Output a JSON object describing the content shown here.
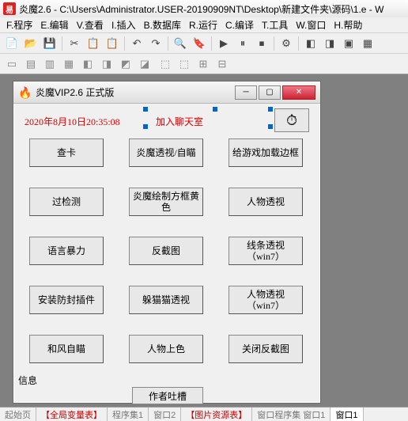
{
  "title": "炎魔2.6 - C:\\Users\\Administrator.USER-20190909NT\\Desktop\\新建文件夹\\源码\\1.e - W",
  "app_icon_glyph": "易",
  "menu": {
    "program": "F.程序",
    "edit": "E.编辑",
    "view": "V.查看",
    "insert": "I.插入",
    "database": "B.数据库",
    "run": "R.运行",
    "compile": "C.编译",
    "tools": "T.工具",
    "window": "W.窗口",
    "help": "H.帮助"
  },
  "toolbar_icons": [
    "📄",
    "📂",
    "💾",
    "",
    "✂",
    "📋",
    "📋",
    "",
    "↶",
    "↷",
    "",
    "🔍",
    "🔖",
    "",
    "▶",
    "⏸",
    "⏹",
    "",
    "⚙",
    "",
    "◧",
    "◨",
    "▣",
    "▦"
  ],
  "toolbar2_icons": [
    "▭",
    "▤",
    "▥",
    "▦",
    "◧",
    "◨",
    "◩",
    "◪",
    "",
    "⬚",
    "⬚",
    "⊞",
    "⊟"
  ],
  "child": {
    "title": "炎魔VIP2.6 正式版",
    "icon": "🔥",
    "timestamp": "2020年8月10日20:35:08",
    "joinchat": "加入聊天室",
    "stopwatch": "⏱",
    "buttons": [
      [
        "查卡",
        "炎魔透视/自瞄",
        "给游戏加载边框"
      ],
      [
        "过检测",
        "炎魔绘制方框黄色",
        "人物透视"
      ],
      [
        "语言暴力",
        "反截图",
        "线条透视（win7）"
      ],
      [
        "安装防封插件",
        "躲猫猫透视",
        "人物透视（win7）"
      ],
      [
        "和风自瞄",
        "人物上色",
        "关闭反截图"
      ]
    ],
    "info_label": "信息",
    "author": "作者吐槽"
  },
  "tabs": [
    "起始页",
    "【全局变量表】",
    "程序集1",
    "窗口2",
    "【图片资源表】",
    "窗口程序集 窗口1",
    "窗口1"
  ]
}
